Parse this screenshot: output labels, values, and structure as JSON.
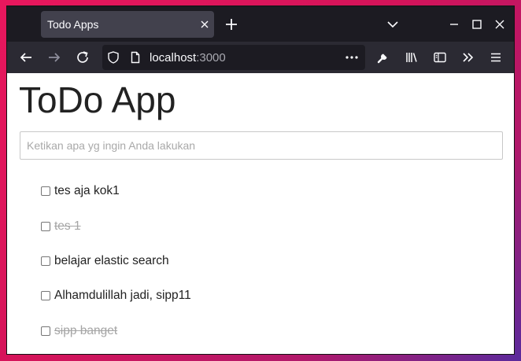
{
  "browser": {
    "tab_title": "Todo Apps",
    "url_host": "localhost",
    "url_port": ":3000"
  },
  "app": {
    "title": "ToDo App",
    "input_placeholder": "Ketikan apa yg ingin Anda lakukan",
    "todos": [
      {
        "text": "tes aja kok1",
        "done": false
      },
      {
        "text": "tes 1",
        "done": true
      },
      {
        "text": "belajar elastic search",
        "done": false
      },
      {
        "text": "Alhamdulillah jadi, sipp11",
        "done": false
      },
      {
        "text": "sipp banget",
        "done": true
      }
    ]
  },
  "colors": {
    "tabbar_bg": "#1c1b22",
    "toolbar_bg": "#2b2a33",
    "desktop_accent": "#e8175d",
    "done_text": "#a5a5a5"
  }
}
